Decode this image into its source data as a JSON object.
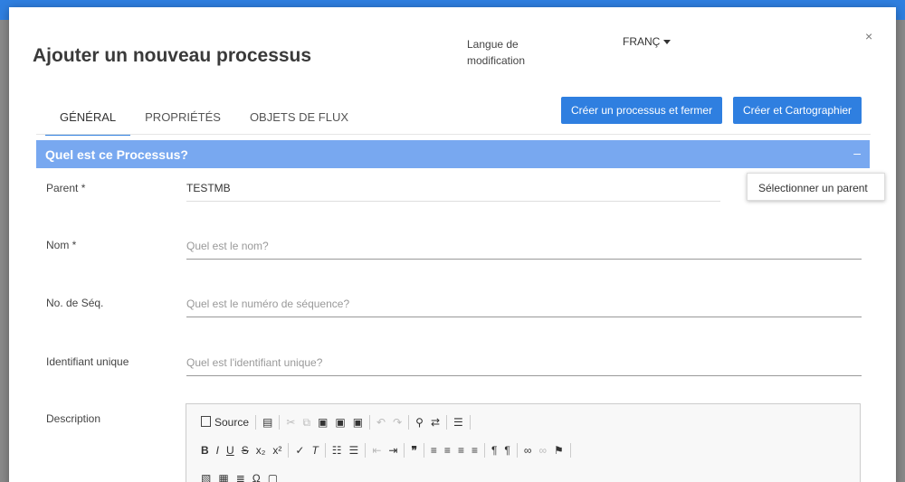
{
  "header": {
    "title": "Ajouter un nouveau processus",
    "lang_label": "Langue de modification",
    "lang_value": "FRANÇ",
    "close": "×"
  },
  "tabs": [
    {
      "label": "GÉNÉRAL",
      "active": true
    },
    {
      "label": "PROPRIÉTÉS",
      "active": false
    },
    {
      "label": "OBJETS DE FLUX",
      "active": false
    }
  ],
  "actions": {
    "create_close": "Créer un processus et fermer",
    "create_map": "Créer et Cartographier"
  },
  "section": {
    "title": "Quel est ce Processus?",
    "toggle": "–"
  },
  "tooltip": "Sélectionner un parent",
  "form": {
    "parent_label": "Parent *",
    "parent_value": "TESTMB",
    "nom_label": "Nom *",
    "nom_placeholder": "Quel est le nom?",
    "seq_label": "No. de Séq.",
    "seq_placeholder": "Quel est le numéro de séquence?",
    "uid_label": "Identifiant unique",
    "uid_placeholder": "Quel est l'identifiant unique?",
    "desc_label": "Description"
  },
  "editor": {
    "source_label": "Source"
  },
  "colors": {
    "accent": "#2f7fe0",
    "section": "#78a8f0"
  }
}
